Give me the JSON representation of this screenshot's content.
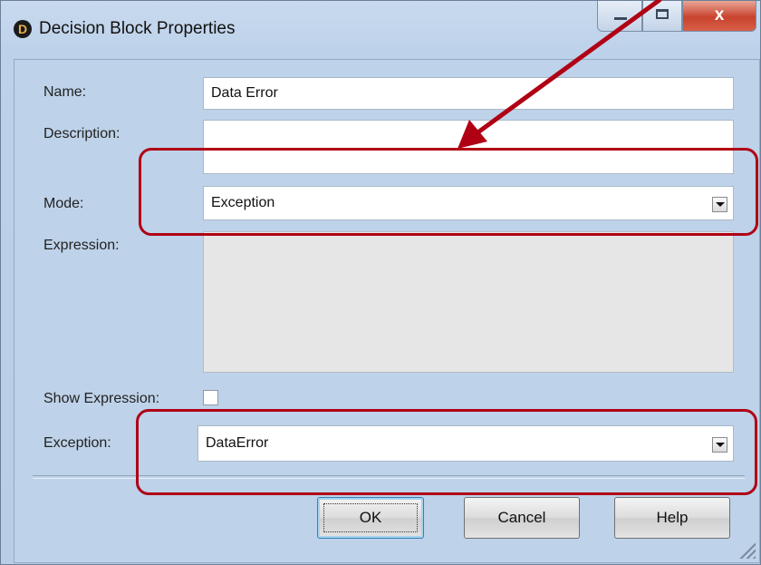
{
  "window": {
    "title": "Decision Block Properties",
    "icon": "app-logo-icon",
    "controls": {
      "minimize": "minimize-icon",
      "maximize": "maximize-icon",
      "close": "x"
    }
  },
  "form": {
    "name_label": "Name:",
    "name_value": "Data Error",
    "description_label": "Description:",
    "description_value": "",
    "mode_label": "Mode:",
    "mode_value": "Exception",
    "expression_label": "Expression:",
    "show_expression_label": "Show Expression:",
    "show_expression_checked": false,
    "exception_label": "Exception:",
    "exception_value": "DataError"
  },
  "buttons": {
    "ok": "OK",
    "cancel": "Cancel",
    "help": "Help"
  },
  "annotations": {
    "highlight_color": "#b00014"
  }
}
